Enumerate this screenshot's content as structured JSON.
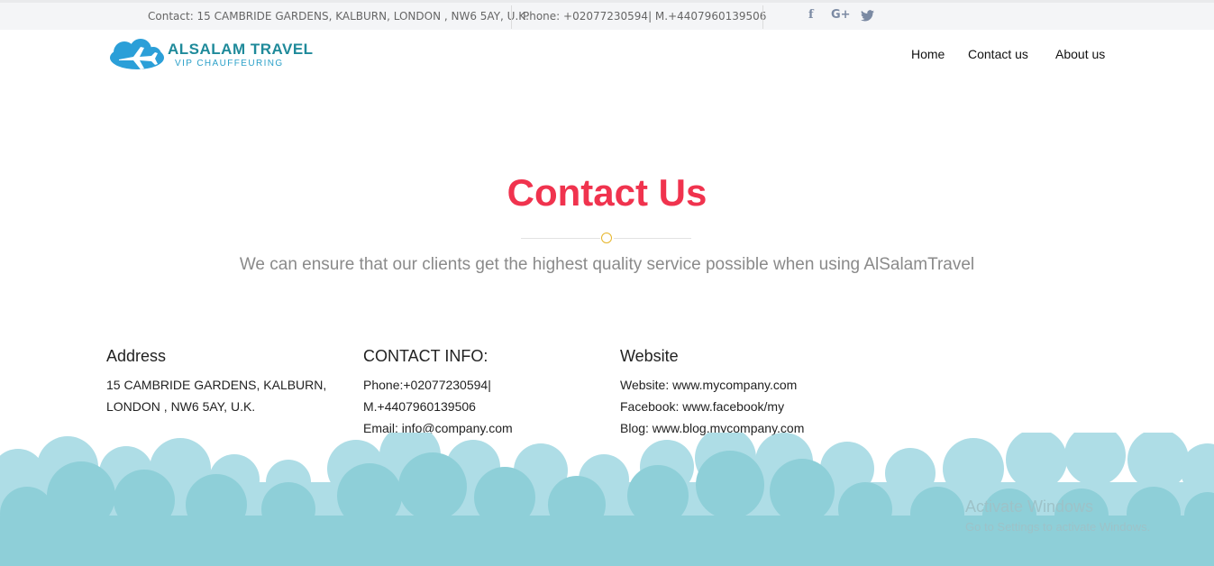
{
  "topbar": {
    "address": "Contact: 15 CAMBRIDE GARDENS, KALBURN, LONDON , NW6 5AY, U.K.",
    "phone": "Phone: +02077230594| M.+4407960139506",
    "social": {
      "facebook": "f",
      "google": "G+",
      "twitter": "twitter-icon"
    }
  },
  "brand": {
    "title": "ALSALAM TRAVEL",
    "subtitle": "VIP CHAUFFEURING",
    "logo_icon": "plane-cloud-icon"
  },
  "nav": {
    "items": [
      {
        "label": "Home"
      },
      {
        "label": "Contact us"
      },
      {
        "label": "About us"
      }
    ]
  },
  "hero": {
    "title": "Contact Us",
    "subtitle": "We can ensure that our clients get the highest quality service possible when using AlSalamTravel"
  },
  "columns": {
    "address": {
      "heading": "Address",
      "lines": [
        "15 CAMBRIDE GARDENS, KALBURN,",
        "LONDON , NW6 5AY, U.K."
      ]
    },
    "contact": {
      "heading": "CONTACT INFO:",
      "lines": [
        "Phone:+02077230594|",
        "M.+4407960139506",
        "Email: info@company.com"
      ]
    },
    "website": {
      "heading": "Website",
      "lines": [
        "Website: www.mycompany.com",
        "Facebook: www.facebook/my",
        "Blog: www.blog.mycompany.com"
      ]
    }
  },
  "watermark": {
    "line1": "Activate Windows",
    "line2": "Go to Settings to activate Windows."
  },
  "colors": {
    "accent": "#f0334e",
    "brand": "#1f8a9a",
    "cloud_light": "#aedde6",
    "cloud_dark": "#8ecfd8",
    "divider_dot": "#e6b529"
  }
}
